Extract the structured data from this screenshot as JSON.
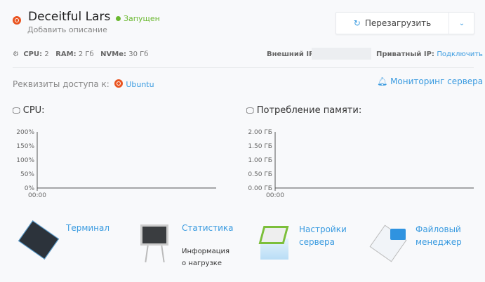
{
  "header": {
    "title": "Deceitful Lars",
    "status": "Запущен",
    "description": "Добавить описание",
    "restart_label": "Перезагрузить",
    "os_icon": "ubuntu-icon"
  },
  "specs": {
    "cpu_label": "CPU:",
    "cpu": "2",
    "ram_label": "RAM:",
    "ram": "2 Гб",
    "disk_label": "NVMe:",
    "disk": "30 Гб",
    "external_ip_label": "Внешний IP:",
    "private_ip_label": "Приватный IP:",
    "private_ip_link": "Подключить"
  },
  "access": {
    "label": "Реквизиты доступа к:",
    "os": "Ubuntu",
    "monitoring": "Мониторинг сервера"
  },
  "colors": {
    "accent": "#3a9be0",
    "status": "#6ab82f",
    "ubuntu": "#e95420"
  },
  "chart_data": [
    {
      "type": "line",
      "title": "CPU:",
      "yticks": [
        "200%",
        "150%",
        "100%",
        "50%",
        "0%"
      ],
      "ylim": [
        0,
        200
      ],
      "xticks": [
        "00:00"
      ],
      "series": []
    },
    {
      "type": "line",
      "title": "Потребление памяти:",
      "yticks": [
        "2.00 ГБ",
        "1.50 ГБ",
        "1.00 ГБ",
        "0.50 ГБ",
        "0.00 ГБ"
      ],
      "ylim": [
        0,
        2
      ],
      "xticks": [
        "00:00"
      ],
      "series": []
    }
  ],
  "tools": [
    {
      "label": "Терминал"
    },
    {
      "label": "Статистика",
      "note1": "Информация",
      "note2": "о нагрузке"
    },
    {
      "label1": "Настройки",
      "label2": "сервера"
    },
    {
      "label1": "Файловый",
      "label2": "менеджер"
    }
  ]
}
